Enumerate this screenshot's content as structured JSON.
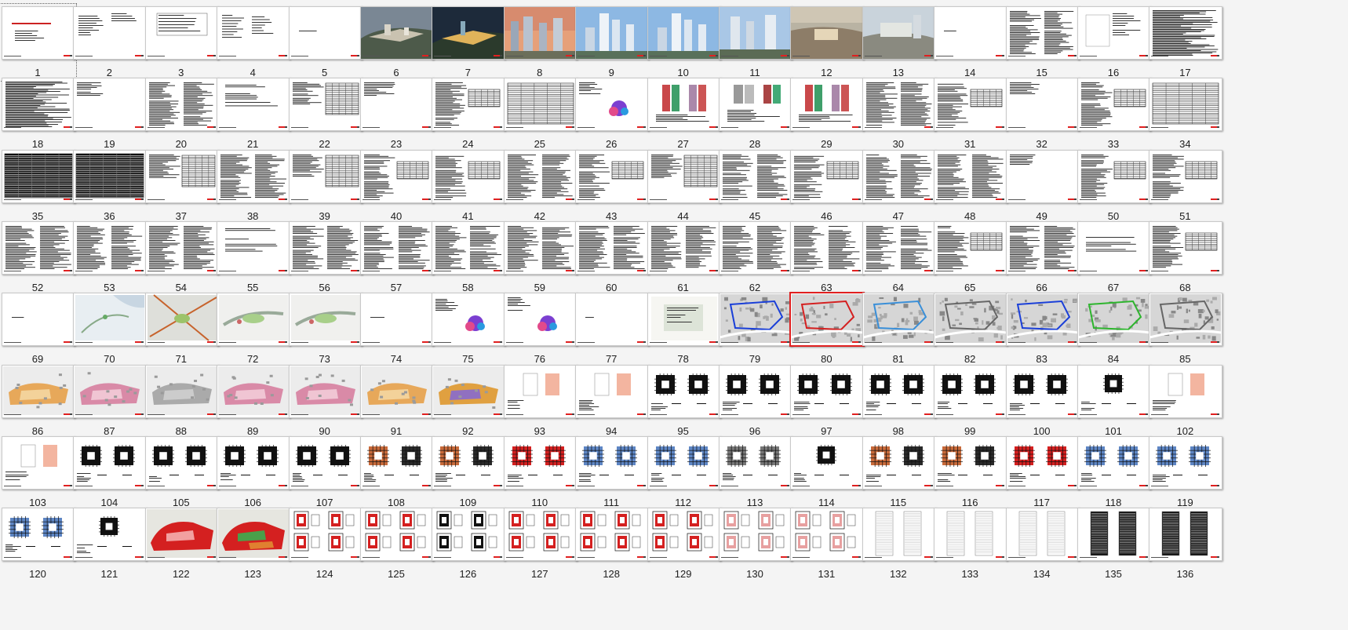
{
  "view": {
    "type": "slide-sorter",
    "selected_slide": 80,
    "accent_color": "#e02020"
  },
  "slides": [
    {
      "n": "1",
      "k": "cover"
    },
    {
      "n": "2",
      "k": "info"
    },
    {
      "n": "3",
      "k": "table-sparse"
    },
    {
      "n": "4",
      "k": "toc"
    },
    {
      "n": "5",
      "k": "section"
    },
    {
      "n": "6",
      "k": "aerial"
    },
    {
      "n": "7",
      "k": "aerial-night"
    },
    {
      "n": "8",
      "k": "towers-sunset"
    },
    {
      "n": "9",
      "k": "towers-blue"
    },
    {
      "n": "10",
      "k": "towers-blue"
    },
    {
      "n": "11",
      "k": "towers-day"
    },
    {
      "n": "12",
      "k": "plaza"
    },
    {
      "n": "13",
      "k": "plaza-day"
    },
    {
      "n": "14",
      "k": "section"
    },
    {
      "n": "15",
      "k": "text-cols"
    },
    {
      "n": "16",
      "k": "form"
    },
    {
      "n": "17",
      "k": "text-dense"
    },
    {
      "n": "18",
      "k": "text-dense"
    },
    {
      "n": "19",
      "k": "text-sparse"
    },
    {
      "n": "20",
      "k": "text-cols"
    },
    {
      "n": "21",
      "k": "text-light"
    },
    {
      "n": "22",
      "k": "table-mix"
    },
    {
      "n": "23",
      "k": "text-sparse"
    },
    {
      "n": "24",
      "k": "text-table"
    },
    {
      "n": "25",
      "k": "table-dense"
    },
    {
      "n": "26",
      "k": "diagram-color"
    },
    {
      "n": "27",
      "k": "bars-color"
    },
    {
      "n": "28",
      "k": "bars-grey"
    },
    {
      "n": "29",
      "k": "bars-color"
    },
    {
      "n": "30",
      "k": "text-cols"
    },
    {
      "n": "31",
      "k": "text-table"
    },
    {
      "n": "32",
      "k": "text-sparse"
    },
    {
      "n": "33",
      "k": "text-table"
    },
    {
      "n": "34",
      "k": "table-dense"
    },
    {
      "n": "35",
      "k": "table-dark"
    },
    {
      "n": "36",
      "k": "table-dark"
    },
    {
      "n": "37",
      "k": "table-mix"
    },
    {
      "n": "38",
      "k": "text-cols"
    },
    {
      "n": "39",
      "k": "table-mix"
    },
    {
      "n": "40",
      "k": "text-table"
    },
    {
      "n": "41",
      "k": "text-table"
    },
    {
      "n": "42",
      "k": "text-cols"
    },
    {
      "n": "43",
      "k": "text-table"
    },
    {
      "n": "44",
      "k": "table-mix"
    },
    {
      "n": "45",
      "k": "text-cols"
    },
    {
      "n": "46",
      "k": "text-table"
    },
    {
      "n": "47",
      "k": "text-cols"
    },
    {
      "n": "48",
      "k": "text-cols"
    },
    {
      "n": "49",
      "k": "text-sparse"
    },
    {
      "n": "50",
      "k": "text-table"
    },
    {
      "n": "51",
      "k": "text-table"
    },
    {
      "n": "52",
      "k": "text-cols"
    },
    {
      "n": "53",
      "k": "text-cols"
    },
    {
      "n": "54",
      "k": "text-cols"
    },
    {
      "n": "55",
      "k": "text-light"
    },
    {
      "n": "56",
      "k": "text-cols"
    },
    {
      "n": "57",
      "k": "text-cols"
    },
    {
      "n": "58",
      "k": "text-cols"
    },
    {
      "n": "59",
      "k": "text-cols"
    },
    {
      "n": "60",
      "k": "text-cols"
    },
    {
      "n": "61",
      "k": "text-cols"
    },
    {
      "n": "62",
      "k": "text-cols"
    },
    {
      "n": "63",
      "k": "text-cols"
    },
    {
      "n": "64",
      "k": "text-cols"
    },
    {
      "n": "65",
      "k": "text-table"
    },
    {
      "n": "66",
      "k": "text-cols"
    },
    {
      "n": "67",
      "k": "text-light"
    },
    {
      "n": "68",
      "k": "text-table"
    },
    {
      "n": "69",
      "k": "section"
    },
    {
      "n": "70",
      "k": "map"
    },
    {
      "n": "71",
      "k": "map-roads"
    },
    {
      "n": "72",
      "k": "map-green"
    },
    {
      "n": "73",
      "k": "map-green"
    },
    {
      "n": "74",
      "k": "section"
    },
    {
      "n": "75",
      "k": "diagram-color"
    },
    {
      "n": "76",
      "k": "diagram-color"
    },
    {
      "n": "77",
      "k": "section"
    },
    {
      "n": "78",
      "k": "siteplan-light"
    },
    {
      "n": "79",
      "k": "siteplan-blue"
    },
    {
      "n": "80",
      "k": "siteplan-red"
    },
    {
      "n": "81",
      "k": "siteplan-mix"
    },
    {
      "n": "82",
      "k": "siteplan-grey"
    },
    {
      "n": "83",
      "k": "siteplan-blue"
    },
    {
      "n": "84",
      "k": "siteplan-green"
    },
    {
      "n": "85",
      "k": "siteplan-grey"
    },
    {
      "n": "86",
      "k": "plan-orange"
    },
    {
      "n": "87",
      "k": "plan-pink"
    },
    {
      "n": "88",
      "k": "plan-grey"
    },
    {
      "n": "89",
      "k": "plan-pink"
    },
    {
      "n": "90",
      "k": "plan-pink"
    },
    {
      "n": "91",
      "k": "plan-orange"
    },
    {
      "n": "92",
      "k": "plan-sparse"
    },
    {
      "n": "93",
      "k": "plan-light"
    },
    {
      "n": "94",
      "k": "plan-light"
    },
    {
      "n": "95",
      "k": "floorplan"
    },
    {
      "n": "96",
      "k": "floorplan"
    },
    {
      "n": "97",
      "k": "floorplan"
    },
    {
      "n": "98",
      "k": "floorplan"
    },
    {
      "n": "99",
      "k": "floorplan"
    },
    {
      "n": "100",
      "k": "floorplan"
    },
    {
      "n": "101",
      "k": "floorplan-single"
    },
    {
      "n": "102",
      "k": "plan-light"
    },
    {
      "n": "103",
      "k": "plan-light"
    },
    {
      "n": "104",
      "k": "floorplan"
    },
    {
      "n": "105",
      "k": "floorplan"
    },
    {
      "n": "106",
      "k": "floorplan"
    },
    {
      "n": "107",
      "k": "floorplan"
    },
    {
      "n": "108",
      "k": "floorplan-color"
    },
    {
      "n": "109",
      "k": "floorplan-color"
    },
    {
      "n": "110",
      "k": "floorplan-red"
    },
    {
      "n": "111",
      "k": "floorplan-blue"
    },
    {
      "n": "112",
      "k": "floorplan-blue"
    },
    {
      "n": "113",
      "k": "floorplan-grey"
    },
    {
      "n": "114",
      "k": "floorplan-single"
    },
    {
      "n": "115",
      "k": "floorplan-color"
    },
    {
      "n": "116",
      "k": "floorplan-color"
    },
    {
      "n": "117",
      "k": "floorplan-red"
    },
    {
      "n": "118",
      "k": "floorplan-blue"
    },
    {
      "n": "119",
      "k": "floorplan-blue"
    },
    {
      "n": "120",
      "k": "floorplan-blue"
    },
    {
      "n": "121",
      "k": "floorplan-single"
    },
    {
      "n": "122",
      "k": "master-red"
    },
    {
      "n": "123",
      "k": "master-mix"
    },
    {
      "n": "124",
      "k": "unit-red"
    },
    {
      "n": "125",
      "k": "unit-red"
    },
    {
      "n": "126",
      "k": "unit-bw"
    },
    {
      "n": "127",
      "k": "unit-red"
    },
    {
      "n": "128",
      "k": "unit-red"
    },
    {
      "n": "129",
      "k": "unit-red"
    },
    {
      "n": "130",
      "k": "unit-light"
    },
    {
      "n": "131",
      "k": "unit-light"
    },
    {
      "n": "132",
      "k": "elevation"
    },
    {
      "n": "133",
      "k": "elevation"
    },
    {
      "n": "134",
      "k": "elevation"
    },
    {
      "n": "135",
      "k": "elevation-dark"
    },
    {
      "n": "136",
      "k": "elevation-dark"
    }
  ]
}
